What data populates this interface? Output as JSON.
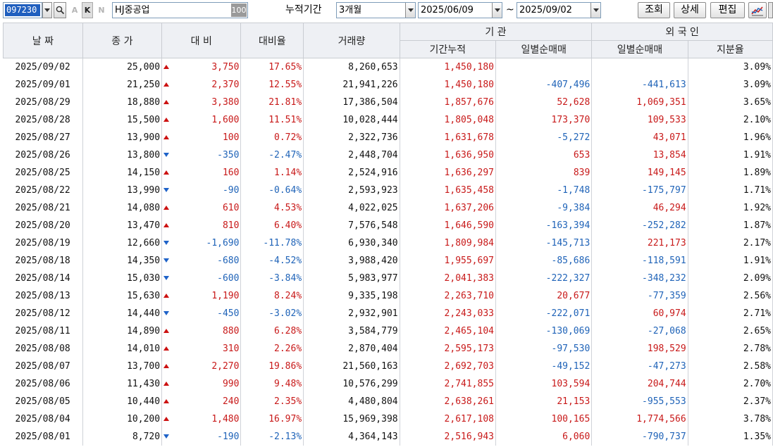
{
  "toolbar": {
    "code": "097230",
    "mode_a": "A",
    "mode_k": "K",
    "mode_n": "N",
    "stock_name": "HJ중공업",
    "stock_badge": "100",
    "period_label": "누적기간",
    "period_value": "3개월",
    "date_from": "2025/06/09",
    "date_sep": "~",
    "date_to": "2025/09/02",
    "query_label": "조회",
    "detail_label": "상세",
    "edit_label": "편집"
  },
  "headers": {
    "date": "날 짜",
    "close": "종 가",
    "diff": "대 비",
    "rate": "대비율",
    "volume": "거래량",
    "inst_group": "기  관",
    "inst_cum": "기간누적",
    "inst_daily": "일별순매매",
    "foreign_group": "외 국 인",
    "foreign_daily": "일별순매매",
    "foreign_share": "지분율"
  },
  "colors": {
    "up": "#c81919",
    "down": "#1f63b8"
  },
  "rows": [
    {
      "date": "2025/09/02",
      "close": "25,000",
      "dir": "up",
      "diff": "3,750",
      "rate": "17.65%",
      "volume": "8,260,653",
      "inst_cum": "1,450,180",
      "inst_daily": "",
      "inst_dir": "",
      "for_daily": "",
      "for_dir": "",
      "share": "3.09%"
    },
    {
      "date": "2025/09/01",
      "close": "21,250",
      "dir": "up",
      "diff": "2,370",
      "rate": "12.55%",
      "volume": "21,941,226",
      "inst_cum": "1,450,180",
      "inst_daily": "-407,496",
      "inst_dir": "dn",
      "for_daily": "-441,613",
      "for_dir": "dn",
      "share": "3.09%"
    },
    {
      "date": "2025/08/29",
      "close": "18,880",
      "dir": "up",
      "diff": "3,380",
      "rate": "21.81%",
      "volume": "17,386,504",
      "inst_cum": "1,857,676",
      "inst_daily": "52,628",
      "inst_dir": "up",
      "for_daily": "1,069,351",
      "for_dir": "up",
      "share": "3.65%"
    },
    {
      "date": "2025/08/28",
      "close": "15,500",
      "dir": "up",
      "diff": "1,600",
      "rate": "11.51%",
      "volume": "10,028,444",
      "inst_cum": "1,805,048",
      "inst_daily": "173,370",
      "inst_dir": "up",
      "for_daily": "109,533",
      "for_dir": "up",
      "share": "2.10%"
    },
    {
      "date": "2025/08/27",
      "close": "13,900",
      "dir": "up",
      "diff": "100",
      "rate": "0.72%",
      "volume": "2,322,736",
      "inst_cum": "1,631,678",
      "inst_daily": "-5,272",
      "inst_dir": "dn",
      "for_daily": "43,071",
      "for_dir": "up",
      "share": "1.96%"
    },
    {
      "date": "2025/08/26",
      "close": "13,800",
      "dir": "dn",
      "diff": "-350",
      "rate": "-2.47%",
      "volume": "2,448,704",
      "inst_cum": "1,636,950",
      "inst_daily": "653",
      "inst_dir": "up",
      "for_daily": "13,854",
      "for_dir": "up",
      "share": "1.91%"
    },
    {
      "date": "2025/08/25",
      "close": "14,150",
      "dir": "up",
      "diff": "160",
      "rate": "1.14%",
      "volume": "2,524,916",
      "inst_cum": "1,636,297",
      "inst_daily": "839",
      "inst_dir": "up",
      "for_daily": "149,145",
      "for_dir": "up",
      "share": "1.89%"
    },
    {
      "date": "2025/08/22",
      "close": "13,990",
      "dir": "dn",
      "diff": "-90",
      "rate": "-0.64%",
      "volume": "2,593,923",
      "inst_cum": "1,635,458",
      "inst_daily": "-1,748",
      "inst_dir": "dn",
      "for_daily": "-175,797",
      "for_dir": "dn",
      "share": "1.71%"
    },
    {
      "date": "2025/08/21",
      "close": "14,080",
      "dir": "up",
      "diff": "610",
      "rate": "4.53%",
      "volume": "4,022,025",
      "inst_cum": "1,637,206",
      "inst_daily": "-9,384",
      "inst_dir": "dn",
      "for_daily": "46,294",
      "for_dir": "up",
      "share": "1.92%"
    },
    {
      "date": "2025/08/20",
      "close": "13,470",
      "dir": "up",
      "diff": "810",
      "rate": "6.40%",
      "volume": "7,576,548",
      "inst_cum": "1,646,590",
      "inst_daily": "-163,394",
      "inst_dir": "dn",
      "for_daily": "-252,282",
      "for_dir": "dn",
      "share": "1.87%"
    },
    {
      "date": "2025/08/19",
      "close": "12,660",
      "dir": "dn",
      "diff": "-1,690",
      "rate": "-11.78%",
      "volume": "6,930,340",
      "inst_cum": "1,809,984",
      "inst_daily": "-145,713",
      "inst_dir": "dn",
      "for_daily": "221,173",
      "for_dir": "up",
      "share": "2.17%"
    },
    {
      "date": "2025/08/18",
      "close": "14,350",
      "dir": "dn",
      "diff": "-680",
      "rate": "-4.52%",
      "volume": "3,988,420",
      "inst_cum": "1,955,697",
      "inst_daily": "-85,686",
      "inst_dir": "dn",
      "for_daily": "-118,591",
      "for_dir": "dn",
      "share": "1.91%"
    },
    {
      "date": "2025/08/14",
      "close": "15,030",
      "dir": "dn",
      "diff": "-600",
      "rate": "-3.84%",
      "volume": "5,983,977",
      "inst_cum": "2,041,383",
      "inst_daily": "-222,327",
      "inst_dir": "dn",
      "for_daily": "-348,232",
      "for_dir": "dn",
      "share": "2.09%"
    },
    {
      "date": "2025/08/13",
      "close": "15,630",
      "dir": "up",
      "diff": "1,190",
      "rate": "8.24%",
      "volume": "9,335,198",
      "inst_cum": "2,263,710",
      "inst_daily": "20,677",
      "inst_dir": "up",
      "for_daily": "-77,359",
      "for_dir": "dn",
      "share": "2.56%"
    },
    {
      "date": "2025/08/12",
      "close": "14,440",
      "dir": "dn",
      "diff": "-450",
      "rate": "-3.02%",
      "volume": "2,932,901",
      "inst_cum": "2,243,033",
      "inst_daily": "-222,071",
      "inst_dir": "dn",
      "for_daily": "60,974",
      "for_dir": "up",
      "share": "2.71%"
    },
    {
      "date": "2025/08/11",
      "close": "14,890",
      "dir": "up",
      "diff": "880",
      "rate": "6.28%",
      "volume": "3,584,779",
      "inst_cum": "2,465,104",
      "inst_daily": "-130,069",
      "inst_dir": "dn",
      "for_daily": "-27,068",
      "for_dir": "dn",
      "share": "2.65%"
    },
    {
      "date": "2025/08/08",
      "close": "14,010",
      "dir": "up",
      "diff": "310",
      "rate": "2.26%",
      "volume": "2,870,404",
      "inst_cum": "2,595,173",
      "inst_daily": "-97,530",
      "inst_dir": "dn",
      "for_daily": "198,529",
      "for_dir": "up",
      "share": "2.78%"
    },
    {
      "date": "2025/08/07",
      "close": "13,700",
      "dir": "up",
      "diff": "2,270",
      "rate": "19.86%",
      "volume": "21,560,163",
      "inst_cum": "2,692,703",
      "inst_daily": "-49,152",
      "inst_dir": "dn",
      "for_daily": "-47,273",
      "for_dir": "dn",
      "share": "2.58%"
    },
    {
      "date": "2025/08/06",
      "close": "11,430",
      "dir": "up",
      "diff": "990",
      "rate": "9.48%",
      "volume": "10,576,299",
      "inst_cum": "2,741,855",
      "inst_daily": "103,594",
      "inst_dir": "up",
      "for_daily": "204,744",
      "for_dir": "up",
      "share": "2.70%"
    },
    {
      "date": "2025/08/05",
      "close": "10,440",
      "dir": "up",
      "diff": "240",
      "rate": "2.35%",
      "volume": "4,480,804",
      "inst_cum": "2,638,261",
      "inst_daily": "21,153",
      "inst_dir": "up",
      "for_daily": "-955,553",
      "for_dir": "dn",
      "share": "2.37%"
    },
    {
      "date": "2025/08/04",
      "close": "10,200",
      "dir": "up",
      "diff": "1,480",
      "rate": "16.97%",
      "volume": "15,969,398",
      "inst_cum": "2,617,108",
      "inst_daily": "100,165",
      "inst_dir": "up",
      "for_daily": "1,774,566",
      "for_dir": "up",
      "share": "3.78%"
    },
    {
      "date": "2025/08/01",
      "close": "8,720",
      "dir": "dn",
      "diff": "-190",
      "rate": "-2.13%",
      "volume": "4,364,143",
      "inst_cum": "2,516,943",
      "inst_daily": "6,060",
      "inst_dir": "up",
      "for_daily": "-790,737",
      "for_dir": "dn",
      "share": "1.35%"
    }
  ]
}
